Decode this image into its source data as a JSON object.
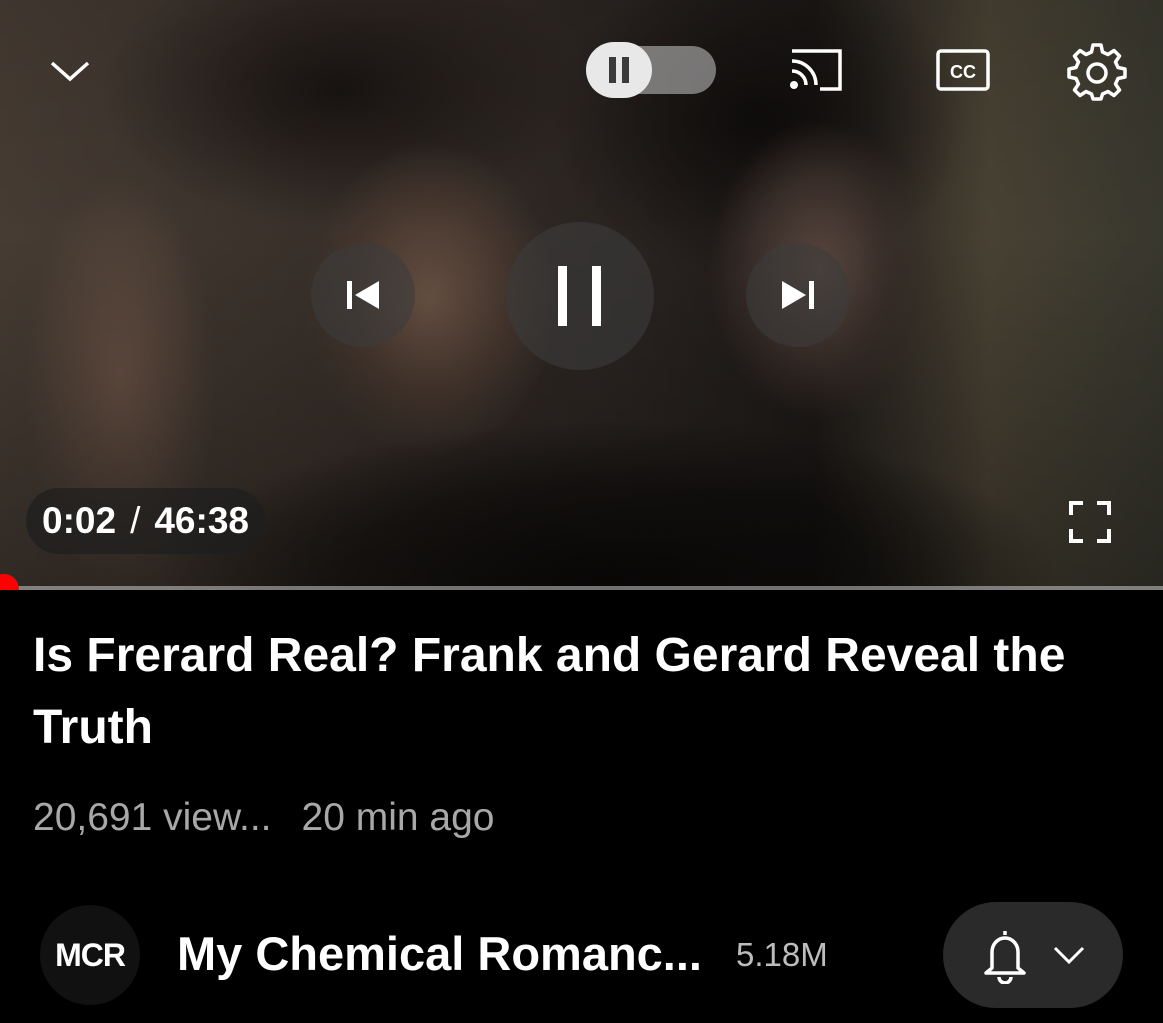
{
  "player": {
    "current_time": "0:02",
    "time_separator": "/",
    "duration": "46:38",
    "progress_fraction": 0.0006,
    "autoplay_enabled": true,
    "accent_color": "#ff0000"
  },
  "video": {
    "title": "Is Frerard Real? Frank and Gerard Reveal the Truth",
    "views": "20,691 view...",
    "uploaded": "20 min ago"
  },
  "channel": {
    "avatar_text": "MCR",
    "name": "My Chemical Romanc...",
    "subscribers": "5.18M"
  },
  "icons": {
    "collapse": "chevron-down-icon",
    "autoplay": "autoplay-toggle-icon",
    "cast": "cast-icon",
    "captions": "cc-icon",
    "settings": "gear-icon",
    "previous": "skip-previous-icon",
    "play_pause": "pause-icon",
    "next": "skip-next-icon",
    "fullscreen": "fullscreen-icon",
    "notifications": "bell-icon",
    "notifications_menu": "chevron-down-icon"
  }
}
